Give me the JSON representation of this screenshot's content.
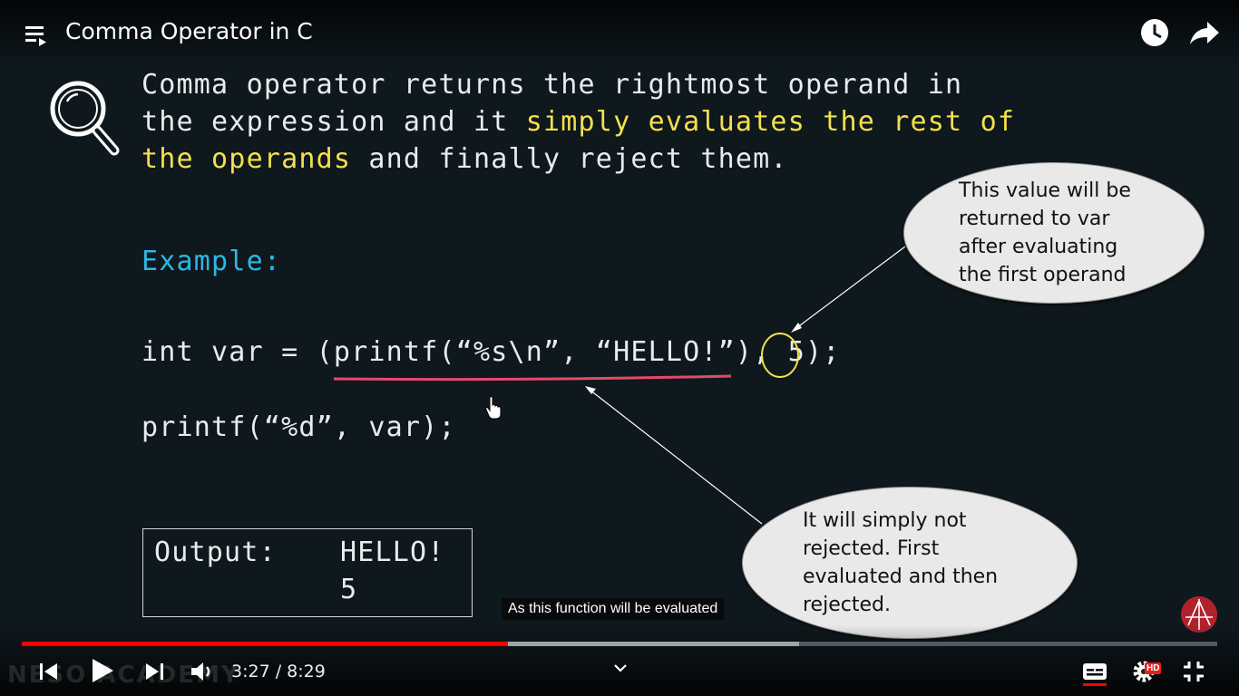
{
  "header": {
    "title": "Comma Operator in C",
    "playlist_icon": "playlist-icon",
    "watch_later_icon": "clock-icon",
    "share_icon": "share-arrow-icon"
  },
  "slide": {
    "definition_line1": "Comma operator returns the rightmost operand in",
    "definition_line2_plain": "the expression and it ",
    "definition_line2_highlight": "simply evaluates the rest of",
    "definition_line3_highlight": "the operands",
    "definition_line3_plain": " and finally reject them.",
    "example_label": "Example:",
    "code_line1_prefix": "int var = (",
    "code_line1_call": "printf(“%s\\n”, “HELLO!”)",
    "code_line1_sep": ", ",
    "code_line1_operand": "5",
    "code_line1_suffix": ");",
    "code_line2": "printf(“%d”, var);",
    "output_label": "Output:",
    "output_line1": "HELLO!",
    "output_line2": "5",
    "callout_top": [
      "This value will be",
      "returned to var",
      "after evaluating",
      "the first operand"
    ],
    "callout_bottom": [
      "It will simply not",
      "rejected. First",
      "evaluated and then",
      "rejected."
    ]
  },
  "caption": "As this function will be evaluated",
  "player": {
    "current_time": "3:27",
    "separator": " / ",
    "duration": "8:29",
    "played_fraction": 0.407,
    "buffered_fraction": 0.65,
    "watermark": "NESO ACADEMY",
    "settings_badge": "HD",
    "colors": {
      "played": "#ff0000",
      "highlight": "#f4e04d",
      "example": "#2ab8e6"
    }
  }
}
